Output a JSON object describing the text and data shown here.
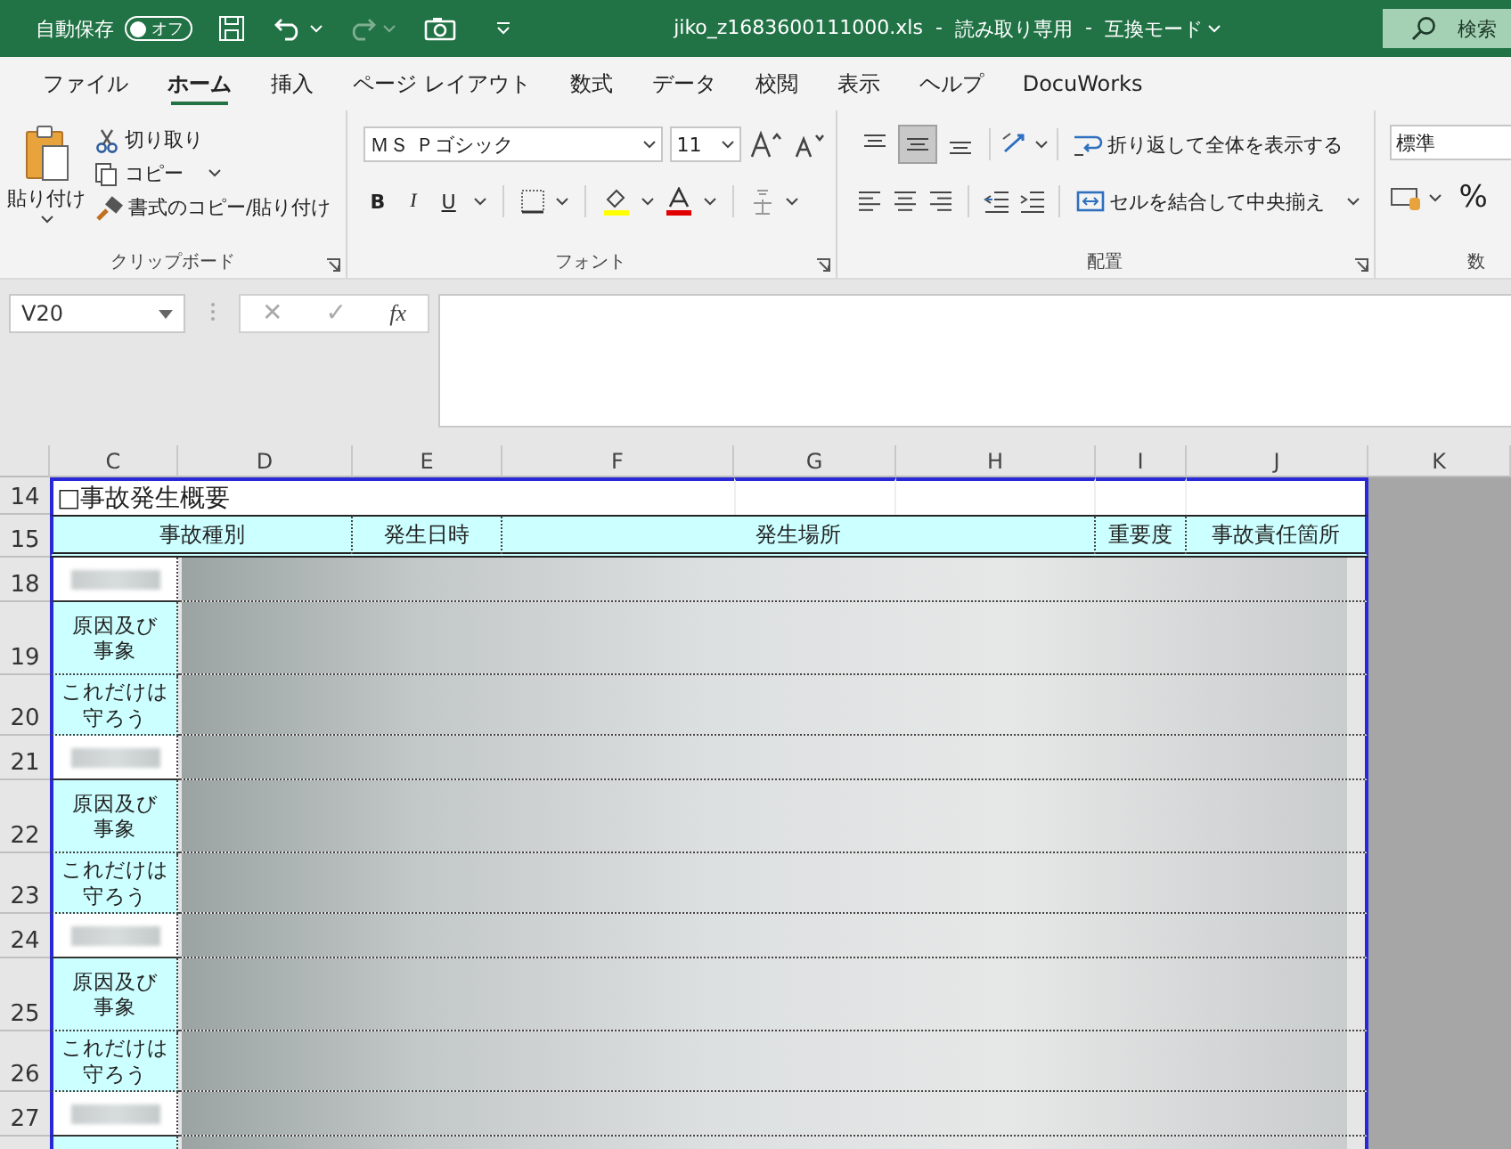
{
  "title_bar": {
    "autosave_label": "自動保存",
    "autosave_toggle": {
      "label": "オフ",
      "on": false
    },
    "filename": "jiko_z1683600111000.xls",
    "separator_1": "-",
    "mode_1": "読み取り専用",
    "separator_2": "-",
    "mode_2": "互換モード",
    "search": {
      "placeholder": "検索"
    }
  },
  "tabs": [
    {
      "label": "ファイル",
      "selected": false
    },
    {
      "label": "ホーム",
      "selected": true
    },
    {
      "label": "挿入",
      "selected": false
    },
    {
      "label": "ページ レイアウト",
      "selected": false
    },
    {
      "label": "数式",
      "selected": false
    },
    {
      "label": "データ",
      "selected": false
    },
    {
      "label": "校閲",
      "selected": false
    },
    {
      "label": "表示",
      "selected": false
    },
    {
      "label": "ヘルプ",
      "selected": false
    },
    {
      "label": "DocuWorks",
      "selected": false
    }
  ],
  "ribbon": {
    "clipboard": {
      "paste": "貼り付け",
      "cut": "切り取り",
      "copy": "コピー",
      "format_painter": "書式のコピー/貼り付け",
      "group_label": "クリップボード"
    },
    "font": {
      "font_name": "ＭＳ Ｐゴシック",
      "font_size": "11",
      "bold": "B",
      "italic": "I",
      "underline": "U",
      "group_label": "フォント"
    },
    "alignment": {
      "wrap_text": "折り返して全体を表示する",
      "merge_center": "セルを結合して中央揃え",
      "group_label": "配置",
      "middle_align_selected": true
    },
    "number": {
      "format": "標準",
      "percent": "%",
      "group_label": "数"
    }
  },
  "formula_bar": {
    "name_box": "V20",
    "cancel": "✕",
    "enter": "✓",
    "function": "fx"
  },
  "sheet": {
    "columns": [
      "C",
      "D",
      "E",
      "F",
      "G",
      "H",
      "I",
      "J",
      "K"
    ],
    "title_row": {
      "number": "14",
      "text": "□事故発生概要"
    },
    "header_row": {
      "number": "15",
      "headers": [
        {
          "label": "事故種別"
        },
        {
          "label": "発生日時"
        },
        {
          "label": "発生場所"
        },
        {
          "label": "重要度"
        },
        {
          "label": "事故責任箇所"
        }
      ]
    },
    "rows": [
      {
        "number": "18",
        "kind": "blurred"
      },
      {
        "number": "19",
        "kind": "cause",
        "label": "原因及び事象"
      },
      {
        "number": "20",
        "kind": "rule",
        "label": "これだけは守ろう"
      },
      {
        "number": "21",
        "kind": "blurred"
      },
      {
        "number": "22",
        "kind": "cause",
        "label": "原因及び事象"
      },
      {
        "number": "23",
        "kind": "rule",
        "label": "これだけは守ろう"
      },
      {
        "number": "24",
        "kind": "blurred"
      },
      {
        "number": "25",
        "kind": "cause",
        "label": "原因及び事象"
      },
      {
        "number": "26",
        "kind": "rule",
        "label": "これだけは守ろう"
      },
      {
        "number": "27",
        "kind": "blurred"
      },
      {
        "kind": "cause"
      }
    ]
  }
}
